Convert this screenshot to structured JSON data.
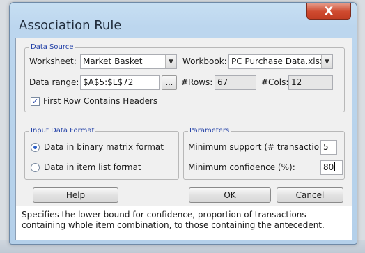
{
  "window": {
    "title": "Association Rule",
    "close_glyph": "X"
  },
  "data_source": {
    "legend": "Data Source",
    "worksheet_label": "Worksheet:",
    "worksheet_value": "Market Basket",
    "workbook_label": "Workbook:",
    "workbook_value": "PC Purchase Data.xlsx",
    "range_label": "Data range:",
    "range_value": "$A$5:$L$72",
    "range_button": "...",
    "rows_label": "#Rows:",
    "rows_value": "67",
    "cols_label": "#Cols:",
    "cols_value": "12",
    "headers_checkbox_label": "First Row Contains Headers",
    "headers_checked": true
  },
  "input_format": {
    "legend": "Input Data Format",
    "option_binary": "Data in binary matrix format",
    "option_list": "Data in item list format",
    "selected": "binary"
  },
  "parameters": {
    "legend": "Parameters",
    "min_support_label": "Minimum support (# transactions):",
    "min_support_value": "5",
    "min_confidence_label": "Minimum confidence (%):",
    "min_confidence_value": "80"
  },
  "buttons": {
    "help": "Help",
    "ok": "OK",
    "cancel": "Cancel"
  },
  "help_text": "Specifies the lower bound for confidence, proportion of transactions containing whole item combination, to those containing the antecedent.",
  "icons": {
    "dropdown": "chevron-down-icon",
    "close": "close-icon",
    "check": "checkmark-icon"
  }
}
